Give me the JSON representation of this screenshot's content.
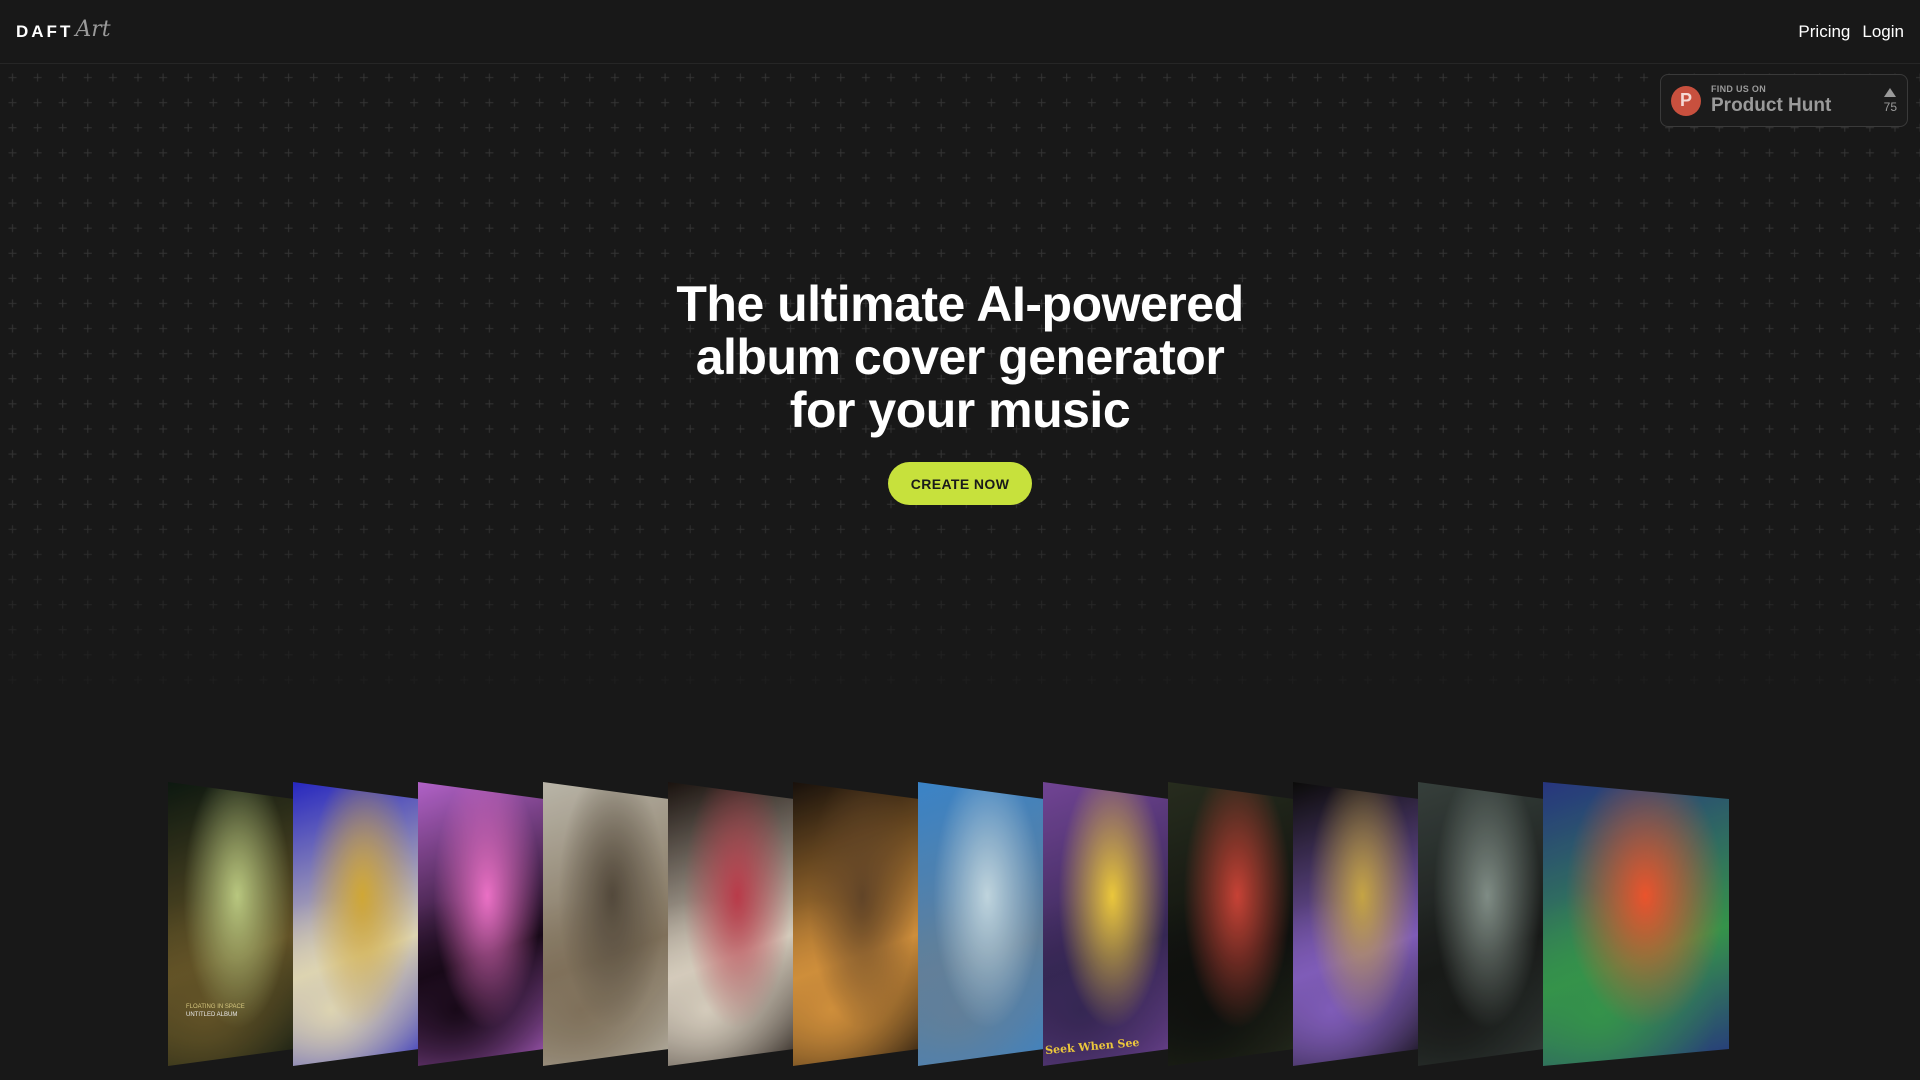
{
  "header": {
    "logo_word": "DAFT",
    "logo_script": "Art",
    "nav": [
      {
        "label": "Pricing"
      },
      {
        "label": "Login"
      }
    ]
  },
  "product_hunt": {
    "small": "FIND US ON",
    "big": "Product Hunt",
    "logo_letter": "P",
    "votes": "75"
  },
  "hero": {
    "lines": [
      "The ultimate AI-powered",
      "album cover generator",
      "for your music"
    ],
    "cta_label": "CREATE NOW"
  },
  "gallery": {
    "covers": [
      {
        "name": "cover-floating-in-space",
        "caption_1": "FLOATING IN SPACE",
        "caption_2": "UNTITLED ALBUM",
        "colors": [
          "#0e1a12",
          "#c8d88a",
          "#6b5a2a"
        ]
      },
      {
        "name": "cover-gold-skull-crown",
        "colors": [
          "#2a2bd0",
          "#e2b53a",
          "#f0e6c0"
        ]
      },
      {
        "name": "cover-pink-spider",
        "colors": [
          "#c06ad8",
          "#ff7ad6",
          "#1a0a1a"
        ]
      },
      {
        "name": "cover-ink-figures",
        "colors": [
          "#c9c4b6",
          "#5a4f40",
          "#8a7a62"
        ]
      },
      {
        "name": "cover-skull-roses",
        "colors": [
          "#1c1410",
          "#c94050",
          "#e6dccb"
        ]
      },
      {
        "name": "cover-dark-tunnel",
        "colors": [
          "#1a120c",
          "#6a4a2a",
          "#e09a40"
        ]
      },
      {
        "name": "cover-dolphins",
        "colors": [
          "#3f8ed8",
          "#cfe6f0",
          "#6a8aa6"
        ]
      },
      {
        "name": "cover-seek-when-see",
        "caption_1": "Seek When See",
        "colors": [
          "#7a4aa0",
          "#ffd840",
          "#3a2a5a"
        ]
      },
      {
        "name": "cover-crow-roses",
        "colors": [
          "#2a3020",
          "#d8483a",
          "#10120f"
        ]
      },
      {
        "name": "cover-gold-frame-crown",
        "colors": [
          "#0c0c0a",
          "#d6b24a",
          "#8a64c8"
        ]
      },
      {
        "name": "cover-spaceship",
        "colors": [
          "#3a4440",
          "#8a9890",
          "#1a1c1a"
        ]
      },
      {
        "name": "cover-neon-palms",
        "colors": [
          "#2a3a8a",
          "#ff5a30",
          "#3aa050"
        ]
      }
    ]
  }
}
